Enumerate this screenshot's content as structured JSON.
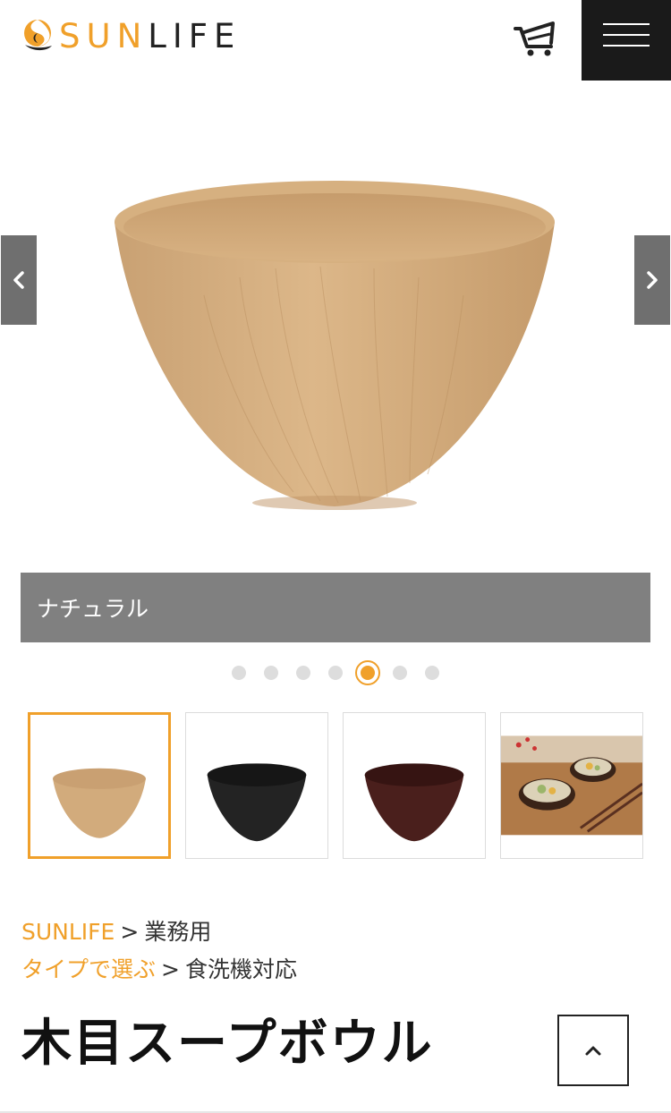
{
  "brand": {
    "sun": "SUN",
    "life": "LIFE",
    "accent_color": "#f0a02a"
  },
  "header": {
    "cart_icon": "cart-icon",
    "menu_icon": "hamburger-menu-icon"
  },
  "carousel": {
    "caption": "ナチュラル",
    "prev_icon": "chevron-left-icon",
    "next_icon": "chevron-right-icon",
    "slide_count": 7,
    "active_slide": 5
  },
  "thumbnails": [
    {
      "variant": "natural",
      "color": "#d2ab7c",
      "active": true
    },
    {
      "variant": "black",
      "color": "#232323",
      "active": false
    },
    {
      "variant": "brown",
      "color": "#4a1f1c",
      "active": false
    },
    {
      "variant": "lifestyle-photo",
      "color": "#b07a48",
      "active": false
    }
  ],
  "breadcrumbs": [
    {
      "link": "SUNLIFE",
      "sep": ">",
      "text": "業務用"
    },
    {
      "link": "タイプで選ぶ",
      "sep": ">",
      "text": "食洗機対応"
    }
  ],
  "product": {
    "title": "木目スープボウル"
  },
  "back_to_top_icon": "chevron-up-icon"
}
